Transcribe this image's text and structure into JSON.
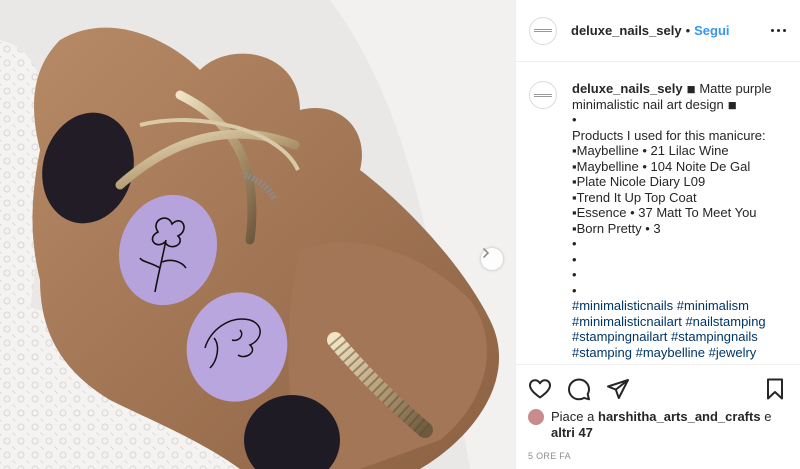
{
  "post": {
    "image_alt": "Matte purple minimalistic nail art design",
    "carousel_next_icon": "chevron-right-icon"
  },
  "header": {
    "username": "deluxe_nails_sely",
    "separator": "•",
    "follow_label": "Segui",
    "more_icon": "more-horizontal-icon"
  },
  "caption": {
    "username": "deluxe_nails_sely",
    "lines": [
      "◾ Matte purple minimalistic nail art design ◾",
      "•",
      "Products I used for this manicure:",
      "▪Maybelline • 21 Lilac Wine",
      "▪Maybelline • 104 Noite De Gal",
      "▪Plate Nicole Diary L09",
      "▪Trend It Up Top Coat",
      "▪Essence • 37 Matt To Meet You",
      "▪Born Pretty • 3",
      "•",
      "•",
      "•",
      "•"
    ],
    "hashtags": [
      "#minimalisticnails",
      "#minimalism",
      "#minimalisticnailart",
      "#nailstamping",
      "#stampingnailart",
      "#stampingnails",
      "#stamping",
      "#maybelline",
      "#jewelry"
    ]
  },
  "actions": {
    "like_icon": "heart-icon",
    "comment_icon": "comment-icon",
    "share_icon": "paper-plane-icon",
    "save_icon": "bookmark-icon"
  },
  "likes": {
    "prefix": "Piace a",
    "user": "harshitha_arts_and_crafts",
    "suffix": "e",
    "others": "altri 47"
  },
  "timestamp": "5 ORE FA",
  "colors": {
    "link": "#3897f0",
    "hashtag": "#003569",
    "text": "#262626",
    "muted": "#8e8e8e",
    "nail_purple": "#b7a3dc",
    "nail_dark": "#1f1b24"
  }
}
